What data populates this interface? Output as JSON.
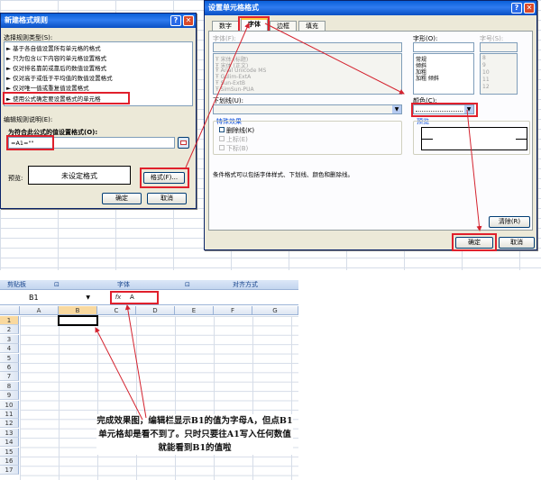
{
  "rule_dialog": {
    "title": "新建格式规则",
    "section_type": "选择规则类型(S):",
    "rule_types": [
      "基于各自值设置所有单元格的格式",
      "只为包含以下内容的单元格设置格式",
      "仅对排名靠前或靠后的数值设置格式",
      "仅对高于或低于平均值的数值设置格式",
      "仅对唯一值或重复值设置格式",
      "使用公式确定要设置格式的单元格"
    ],
    "section_edit": "编辑规则说明(E):",
    "formula_label": "为符合此公式的值设置格式(O):",
    "formula_value": "=A1=\"\"",
    "preview_label": "预览:",
    "preview_text": "未设定格式",
    "format_button": "格式(F)...",
    "ok_button": "确定",
    "cancel_button": "取消"
  },
  "format_dialog": {
    "title": "设置单元格格式",
    "tabs": [
      "数字",
      "字体",
      "边框",
      "填充"
    ],
    "font_label": "字体(F):",
    "font_items": [
      "宋体 (标题)",
      "宋体 (正文)",
      "Arial Unicode MS",
      "Gulim-ExtA",
      "Sun-ExtB",
      "SimSun-PUA"
    ],
    "style_label": "字形(O):",
    "style_items": [
      "常规",
      "倾斜",
      "加粗",
      "加粗 倾斜"
    ],
    "size_label": "字号(S):",
    "size_items": [
      "8",
      "9",
      "10",
      "11",
      "12"
    ],
    "underline_label": "下划线(U):",
    "color_label": "颜色(C):",
    "effects_label": "特殊效果",
    "effects": [
      "删除线(K)",
      "上标(E)",
      "下标(B)"
    ],
    "preview_label": "预览",
    "note": "条件格式可以包括字体样式、下划线、颜色和删除线。",
    "clear_button": "清除(R)",
    "ok_button": "确定",
    "cancel_button": "取消"
  },
  "sheet": {
    "ribbon_groups": [
      "剪贴板",
      "字体",
      "对齐方式"
    ],
    "name_box": "B1",
    "fx": "fx",
    "formula_content": "A",
    "columns": [
      "A",
      "B",
      "C",
      "D",
      "E",
      "F",
      "G"
    ],
    "rows": [
      "1",
      "2",
      "3",
      "4",
      "5",
      "6",
      "7",
      "8",
      "9",
      "10",
      "11",
      "12",
      "13",
      "14",
      "15",
      "16",
      "17"
    ],
    "annotation": "完成效果图，编辑栏显示B1的值为字母A，但点B1单元格却是看不到了。只时只要往A1写入任何数值就能看到B1的值啦"
  },
  "colors": {
    "accent_red": "#e0202c",
    "title_blue": "#0a5fd8",
    "dialog_bg": "#ece9d8",
    "selected": "#316ac5"
  }
}
